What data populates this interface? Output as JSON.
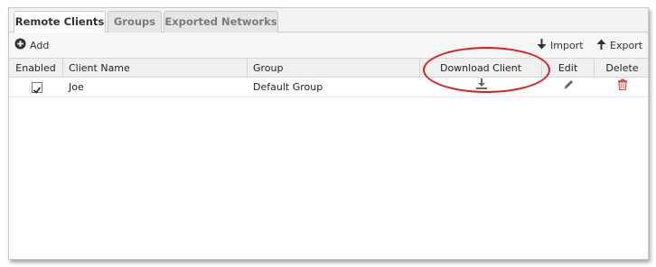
{
  "tabs": [
    {
      "label": "Remote Clients",
      "active": true
    },
    {
      "label": "Groups",
      "active": false
    },
    {
      "label": "Exported Networks",
      "active": false
    }
  ],
  "toolbar": {
    "add_label": "Add",
    "import_label": "Import",
    "export_label": "Export"
  },
  "table": {
    "columns": [
      "Enabled",
      "Client Name",
      "Group",
      "Download Client",
      "Edit",
      "Delete"
    ],
    "rows": [
      {
        "enabled": true,
        "client_name": "Joe",
        "group": "Default Group"
      }
    ]
  },
  "icons": {
    "add": "plus-circle-icon",
    "import": "arrow-down-icon",
    "export": "arrow-up-icon",
    "download": "download-icon",
    "edit": "pencil-icon",
    "delete": "trash-icon"
  },
  "colors": {
    "annotation": "#e11b1b",
    "delete_icon": "#d9534f",
    "icon_gray": "#666666"
  }
}
